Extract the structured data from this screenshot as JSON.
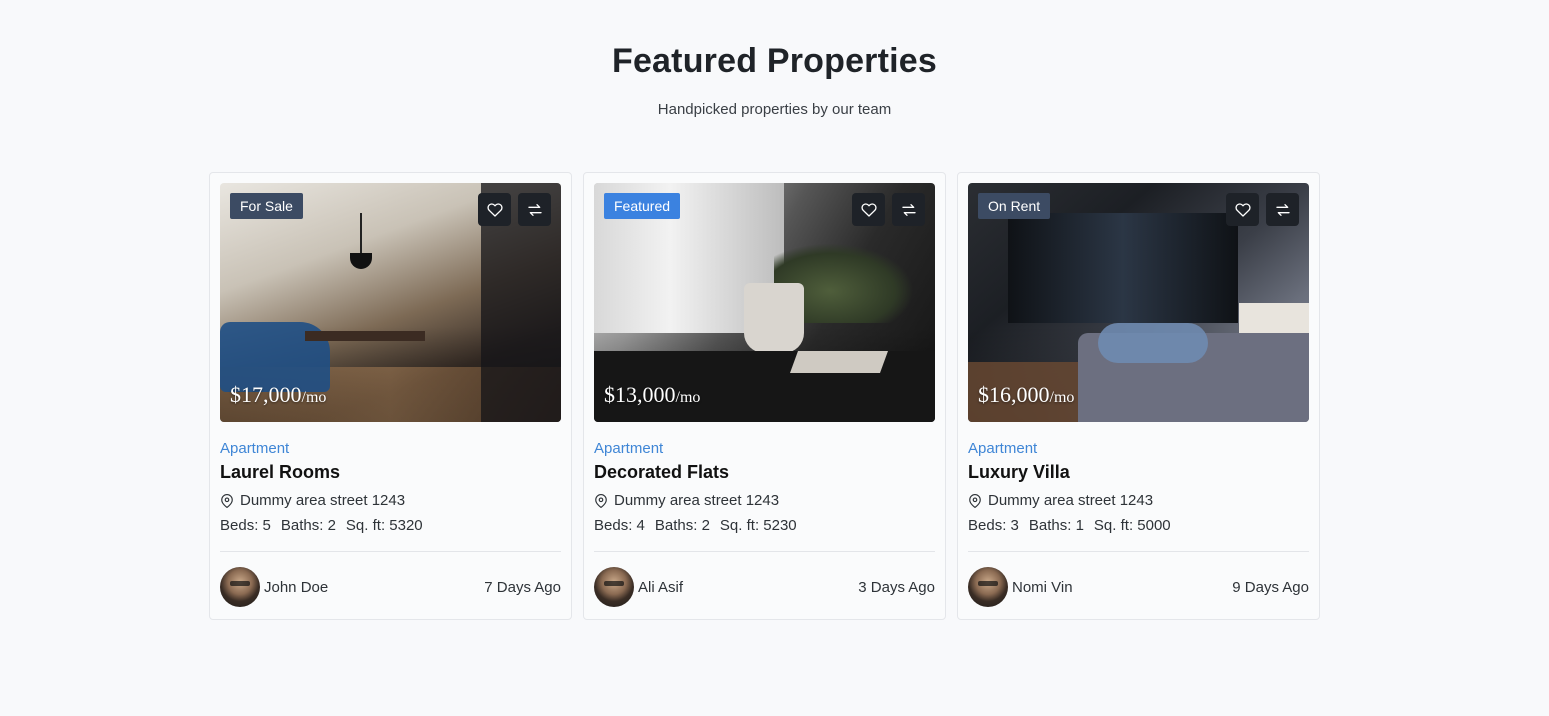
{
  "header": {
    "title": "Featured Properties",
    "subtitle": "Handpicked properties by our team"
  },
  "icons": {
    "favorite": "heart-icon",
    "compare": "compare-arrows-icon",
    "location": "map-pin-icon"
  },
  "colors": {
    "accent": "#3b82e0",
    "category": "#3f86d6",
    "badge_default": "#3c4b63",
    "icon_button": "#1e2228"
  },
  "properties": [
    {
      "badge": "For Sale",
      "price": "$17,000",
      "price_unit": "/mo",
      "category": "Apartment",
      "name": "Laurel Rooms",
      "address": "Dummy area street 1243",
      "beds": "Beds: 5",
      "baths": "Baths: 2",
      "sqft": "Sq. ft: 5320",
      "agent": "John Doe",
      "posted": "7 Days Ago"
    },
    {
      "badge": "Featured",
      "price": "$13,000",
      "price_unit": "/mo",
      "category": "Apartment",
      "name": "Decorated Flats",
      "address": "Dummy area street 1243",
      "beds": "Beds: 4",
      "baths": "Baths: 2",
      "sqft": "Sq. ft: 5230",
      "agent": "Ali Asif",
      "posted": "3 Days Ago"
    },
    {
      "badge": "On Rent",
      "price": "$16,000",
      "price_unit": "/mo",
      "category": "Apartment",
      "name": "Luxury Villa",
      "address": "Dummy area street 1243",
      "beds": "Beds: 3",
      "baths": "Baths: 1",
      "sqft": "Sq. ft: 5000",
      "agent": "Nomi Vin",
      "posted": "9 Days Ago"
    }
  ]
}
